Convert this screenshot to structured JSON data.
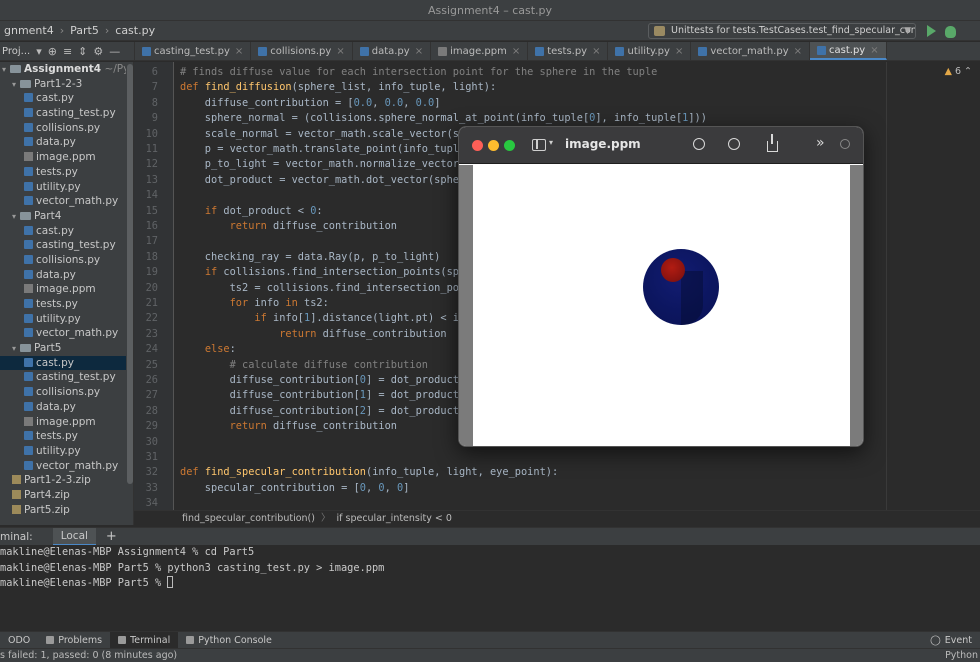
{
  "window": {
    "title": "Assignment4 – cast.py"
  },
  "navbar": {
    "crumbs": [
      "gnment4",
      "Part5",
      "cast.py"
    ],
    "run_config": "Unittests for tests.TestCases.test_find_specular_contribution"
  },
  "project_tools": {
    "label": "Proj...",
    "arrow": "▾"
  },
  "tabs": [
    {
      "label": "casting_test.py"
    },
    {
      "label": "collisions.py"
    },
    {
      "label": "data.py"
    },
    {
      "label": "image.ppm"
    },
    {
      "label": "tests.py"
    },
    {
      "label": "utility.py"
    },
    {
      "label": "vector_math.py"
    },
    {
      "label": "cast.py"
    }
  ],
  "tree": {
    "root": "Assignment4",
    "root_path": "~/Pycharm",
    "items": [
      "Part1-2-3",
      "cast.py",
      "casting_test.py",
      "collisions.py",
      "data.py",
      "image.ppm",
      "tests.py",
      "utility.py",
      "vector_math.py",
      "Part4",
      "cast.py",
      "casting_test.py",
      "collisions.py",
      "data.py",
      "image.ppm",
      "tests.py",
      "utility.py",
      "vector_math.py",
      "Part5",
      "cast.py",
      "casting_test.py",
      "collisions.py",
      "data.py",
      "image.ppm",
      "tests.py",
      "utility.py",
      "vector_math.py",
      "Part1-2-3.zip",
      "Part4.zip",
      "Part5.zip"
    ]
  },
  "editor": {
    "warnings": "6",
    "line_numbers": [
      "6",
      "7",
      "8",
      "9",
      "10",
      "11",
      "12",
      "13",
      "14",
      "15",
      "16",
      "17",
      "18",
      "19",
      "20",
      "21",
      "22",
      "23",
      "24",
      "25",
      "26",
      "27",
      "28",
      "29",
      "30",
      "31",
      "32",
      "33",
      "34"
    ],
    "lines": [
      "# finds diffuse value for each intersection point for the sphere in the tuple",
      "def find_diffusion(sphere_list, info_tuple, light):",
      "    diffuse_contribution = [0.0, 0.0, 0.0]",
      "    sphere_normal = (collisions.sphere_normal_at_point(info_tuple[0], info_tuple[1]))",
      "    scale_normal = vector_math.scale_vector(sph",
      "    p = vector_math.translate_point(info_tuple[",
      "    p_to_light = vector_math.normalize_vector(v",
      "    dot_product = vector_math.dot_vector(sphere",
      "",
      "    if dot_product < 0:",
      "        return diffuse_contribution",
      "",
      "    checking_ray = data.Ray(p, p_to_light)",
      "    if collisions.find_intersection_points(sphe",
      "        ts2 = collisions.find_intersection_point",
      "        for info in ts2:",
      "            if info[1].distance(light.pt) < inf",
      "                return diffuse_contribution",
      "    else:",
      "        # calculate diffuse contribution",
      "        diffuse_contribution[0] = dot_product *",
      "        diffuse_contribution[1] = dot_product *",
      "        diffuse_contribution[2] = dot_product *",
      "        return diffuse_contribution",
      "",
      "",
      "def find_specular_contribution(info_tuple, light, eye_point):",
      "    specular_contribution = [0, 0, 0]",
      ""
    ]
  },
  "editor_crumbs": [
    "find_specular_contribution()",
    "if specular_intensity < 0"
  ],
  "terminal": {
    "label": "minal:",
    "tab": "Local",
    "add": "+",
    "lines": [
      "makline@Elenas-MBP Assignment4 % cd Part5",
      "makline@Elenas-MBP Part5 % python3 casting_test.py > image.ppm",
      "makline@Elenas-MBP Part5 % "
    ]
  },
  "toolwindows": [
    "ODO",
    "Problems",
    "Terminal",
    "Python Console"
  ],
  "toolwindow_right": "Event",
  "status": {
    "left": "s failed: 1, passed: 0 (8 minutes ago)",
    "right": "Python"
  },
  "preview": {
    "title": "image.ppm",
    "more": "»"
  },
  "colors": {
    "accent": "#4a88c7",
    "sphere_blue": "#0c1660",
    "sphere_red": "#8e1410"
  }
}
